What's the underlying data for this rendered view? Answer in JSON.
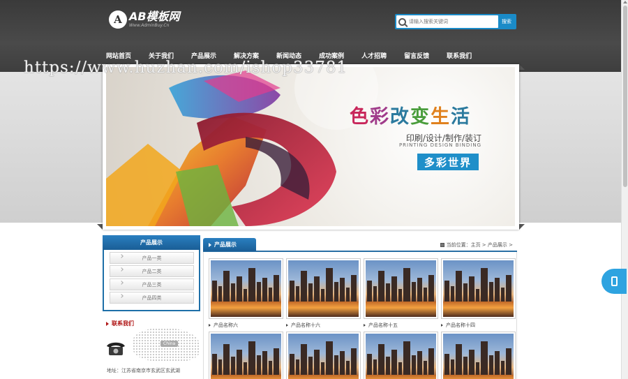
{
  "header": {
    "logo_mark": "A",
    "logo_title": "AB模板网",
    "logo_subtitle": "Www.AdminBuy.Cn"
  },
  "search": {
    "placeholder": "请输入搜索关键词",
    "button_label": "搜索"
  },
  "nav": {
    "items": [
      "网站首页",
      "关于我们",
      "产品展示",
      "解决方案",
      "新闻动态",
      "成功案例",
      "人才招聘",
      "留言反馈",
      "联系我们"
    ]
  },
  "watermark": "https://www.huzhan.com/ishop33781",
  "banner": {
    "title_chars": [
      "色",
      "彩",
      "改",
      "变",
      "生",
      "活"
    ],
    "title_colors": [
      "#c8265a",
      "#a03b8a",
      "#2b7a9e",
      "#4a9d3c",
      "#e0811e",
      "#2b7a9e"
    ],
    "subtitle": "印刷/设计/制作/装订",
    "subtitle_en": "PRINTING DESIGN BINDING",
    "badge": "多彩世界"
  },
  "sidebar": {
    "title": "产品展示",
    "items": [
      "产品一类",
      "产品二类",
      "产品三类",
      "产品四类"
    ],
    "contact_title": "联系我们",
    "map_tag": "China",
    "address": "地址：江苏省南京市玄武区玄武湖"
  },
  "main": {
    "tab": "产品展示",
    "breadcrumb": {
      "prefix": "当前位置：",
      "home": "主页",
      "sep1": " > ",
      "current": "产品展示",
      "sep2": " >"
    },
    "products": [
      "产品名称六",
      "产品名称十六",
      "产品名称十五",
      "产品名称十四",
      "",
      "",
      "",
      ""
    ]
  },
  "colors": {
    "accent": "#1a8bc8",
    "header_bg": "#3a3a3a",
    "sidebar_blue": "#1e6fa8",
    "contact_red": "#b01818"
  },
  "icons": {
    "search": "search-icon",
    "phone": "phone-icon",
    "breadcrumb": "location-icon"
  }
}
